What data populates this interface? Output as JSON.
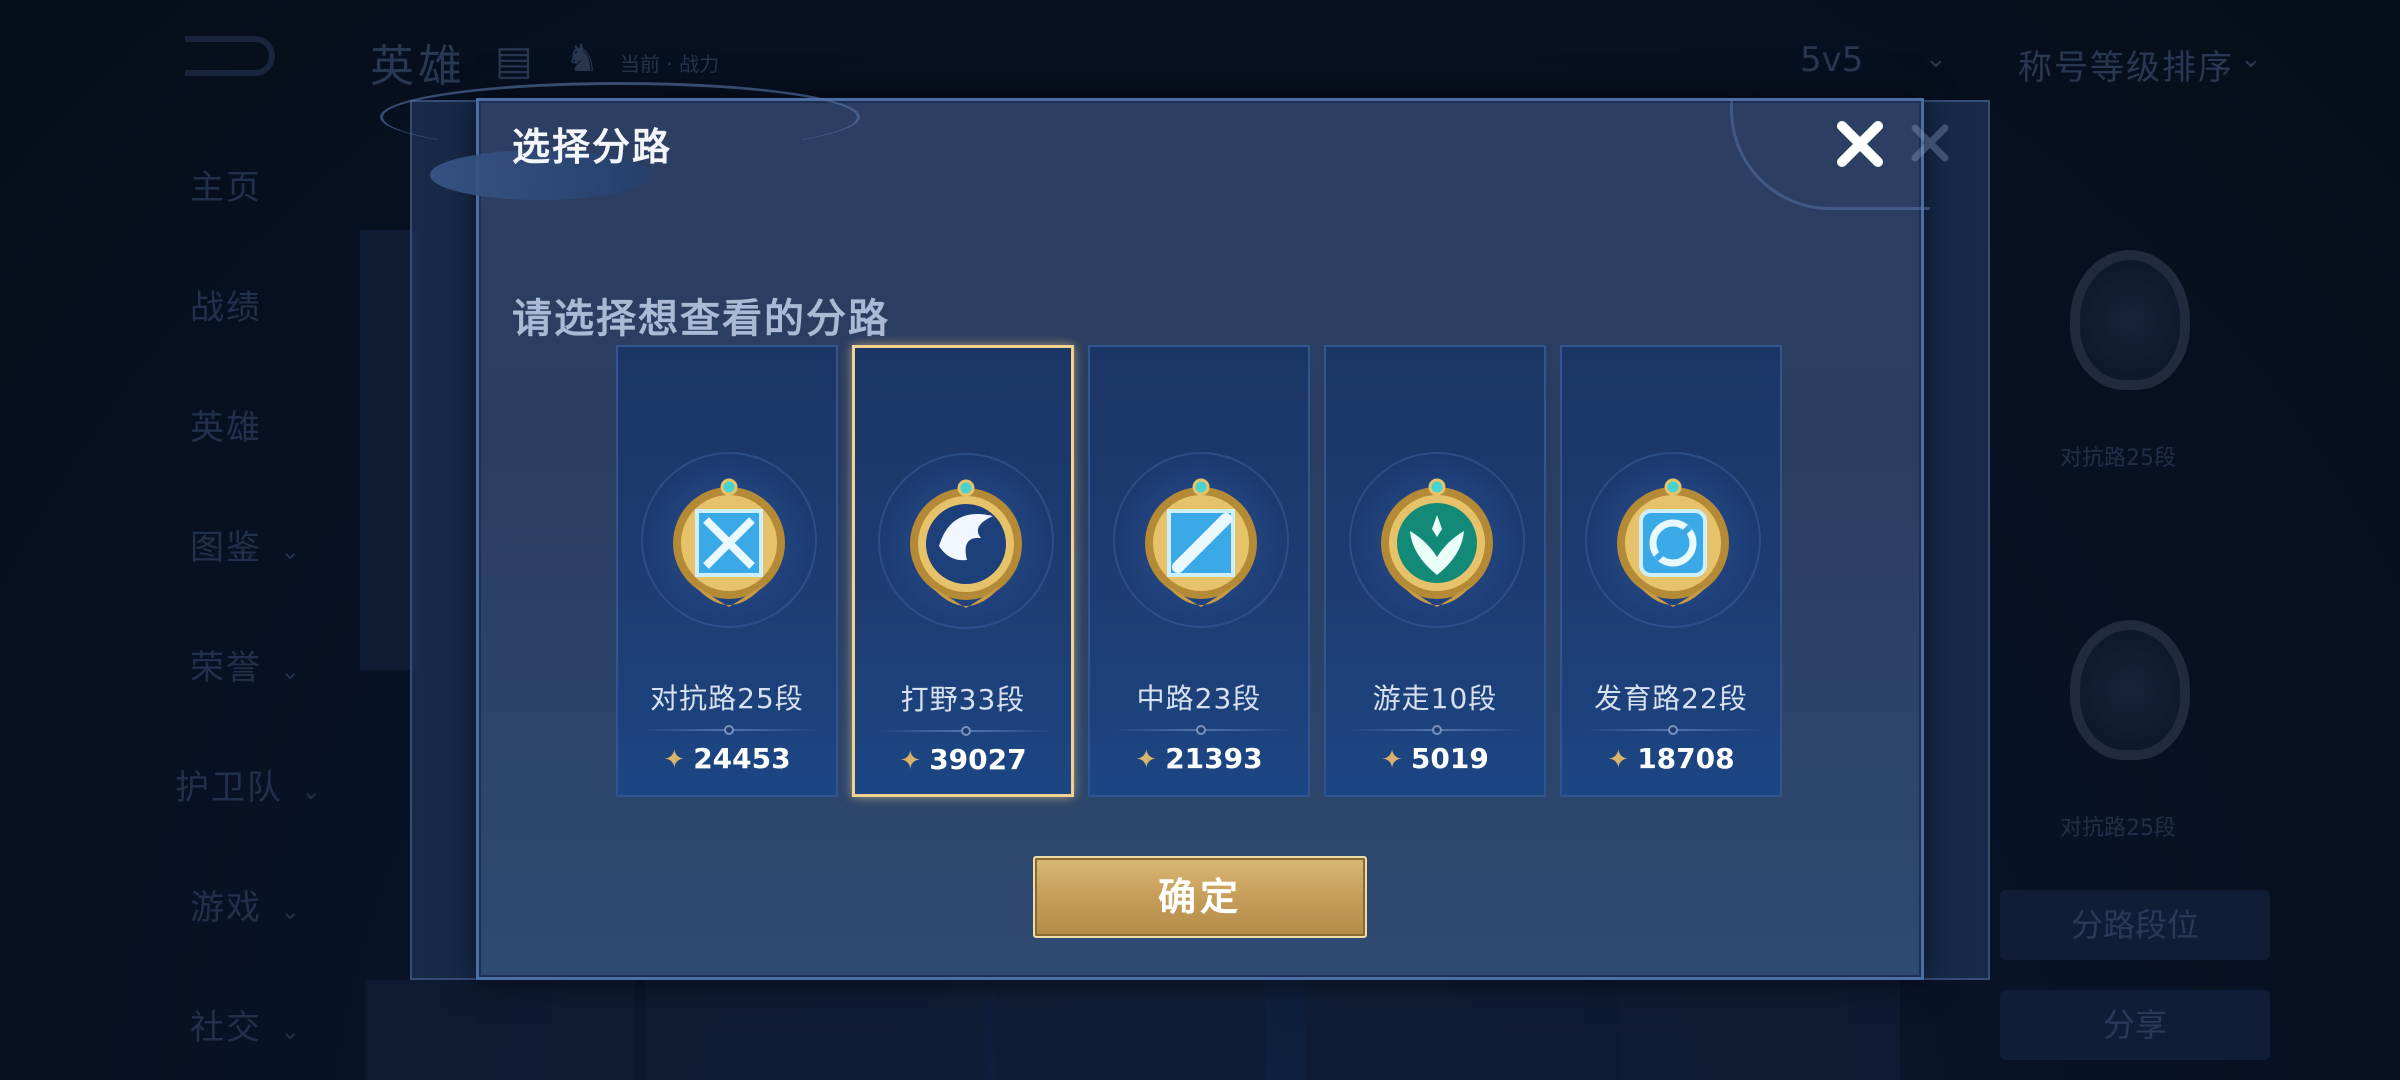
{
  "background": {
    "title": "英雄",
    "small_text": "当前 · 战力",
    "mode": "5v5",
    "sort": "称号等级排序",
    "sidebar": [
      "主页",
      "战绩",
      "英雄",
      "图鉴",
      "荣誉",
      "护卫队",
      "游戏",
      "社交"
    ],
    "right_panel": {
      "label_1": "对抗路25段",
      "label_2": "对抗路25段",
      "btn_lane_rank": "分路段位",
      "btn_share": "分享"
    }
  },
  "modal": {
    "title": "选择分路",
    "subtitle": "请选择想查看的分路",
    "confirm": "确定",
    "lanes": [
      {
        "label": "对抗路25段",
        "score": "24453",
        "icon": "clash-lane-medal-icon",
        "selected": false
      },
      {
        "label": "打野33段",
        "score": "39027",
        "icon": "jungle-medal-icon",
        "selected": true
      },
      {
        "label": "中路23段",
        "score": "21393",
        "icon": "mid-lane-medal-icon",
        "selected": false
      },
      {
        "label": "游走10段",
        "score": "5019",
        "icon": "roam-medal-icon",
        "selected": false
      },
      {
        "label": "发育路22段",
        "score": "18708",
        "icon": "farm-lane-medal-icon",
        "selected": false
      }
    ]
  },
  "colors": {
    "gold": "#d7b46a",
    "selected_border": "#f2d28e",
    "modal_bg": "#2c3f63",
    "confirm_bg": "#c8a05c"
  }
}
